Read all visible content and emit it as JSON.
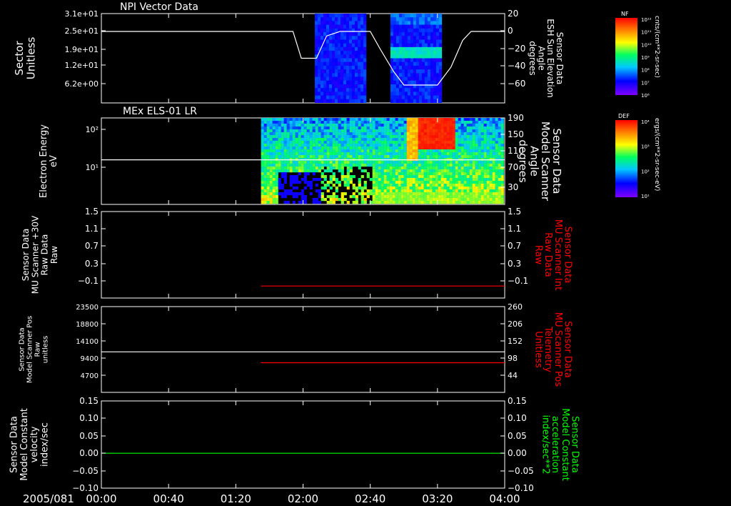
{
  "time_axis": {
    "date_label": "2005/081",
    "ticks": [
      "00:00",
      "00:40",
      "01:20",
      "02:00",
      "02:40",
      "03:20",
      "04:00"
    ],
    "start_min": 0,
    "end_min": 240
  },
  "chart_data": [
    {
      "type": "heatmap",
      "title": "NPI Vector Data",
      "ylabel": "Sector\nUnitless",
      "y_ticks": [
        "3.1e+01",
        "2.5e+01",
        "1.9e+01",
        "1.2e+01",
        "6.2e+00"
      ],
      "y2label": "Sensor Data\nESH Sun Elevation\nAngle\ndegrees",
      "y2_ticks": [
        "20",
        "0",
        "−20",
        "−40",
        "−60"
      ],
      "y2lim": [
        -80,
        20
      ],
      "colorbar": {
        "label": "NF",
        "unit": "cnts/(cm**2-sr-sec)",
        "ticks": [
          "10¹²",
          "10¹¹",
          "10¹⁰",
          "10⁹",
          "10⁸",
          "10⁷",
          "10⁶"
        ]
      },
      "data_intervals": [
        {
          "start_min": 127,
          "end_min": 158
        },
        {
          "start_min": 172,
          "end_min": 203
        }
      ],
      "line_series": {
        "name": "ESH Sun Elevation Angle",
        "color": "#ffffff",
        "points": [
          [
            0,
            0
          ],
          [
            114,
            0
          ],
          [
            119,
            -30
          ],
          [
            128,
            -30
          ],
          [
            134,
            -5
          ],
          [
            142,
            0
          ],
          [
            160,
            0
          ],
          [
            166,
            -20
          ],
          [
            174,
            -45
          ],
          [
            180,
            -60
          ],
          [
            200,
            -60
          ],
          [
            208,
            -40
          ],
          [
            215,
            -10
          ],
          [
            220,
            0
          ],
          [
            240,
            0
          ]
        ]
      }
    },
    {
      "type": "heatmap",
      "title": "MEx ELS-01 LR",
      "ylabel": "Electron Energy\neV",
      "y_ticks": [
        "10²",
        "10¹"
      ],
      "yscale": "log",
      "y2label": "Sensor Data\nModel Scanner\nAngle\ndegrees",
      "y2_ticks": [
        "190",
        "150",
        "110",
        "70",
        "30"
      ],
      "y2lim": [
        0,
        190
      ],
      "colorbar": {
        "label": "DEF",
        "unit": "ergs/(cm**2-sr-sec-eV)",
        "ticks": [
          "10⁴",
          "10³",
          "10²",
          "10¹"
        ]
      },
      "data_interval": {
        "start_min": 95,
        "end_min": 240
      },
      "line_series": {
        "name": "Model Scanner Angle",
        "color": "#ffffff",
        "constant": 98
      }
    },
    {
      "type": "line",
      "ylabel": "Sensor Data\nMU Scanner +30V\nRaw Data\nRaw",
      "y_ticks": [
        "1.5",
        "1.1",
        "0.7",
        "0.3",
        "−0.1"
      ],
      "ylim": [
        -0.3,
        1.5
      ],
      "y2label": "Sensor Data\nMU Scanner Int\nRaw Data\nRaw",
      "y2_ticks": [
        "1.5",
        "1.1",
        "0.7",
        "0.3",
        "−0.1"
      ],
      "y2lim": [
        -0.3,
        1.5
      ],
      "y2_color": "#ff0000",
      "series": [
        {
          "name": "MU Scanner Int",
          "color": "#ff0000",
          "axis": "right",
          "x": [
            95,
            240
          ],
          "values": [
            -0.05,
            -0.05
          ]
        }
      ]
    },
    {
      "type": "line",
      "ylabel": "Sensor Data\nModel Scanner Pos\nRaw\nunitless",
      "y_ticks": [
        "23500",
        "18800",
        "14100",
        "9400",
        "4700"
      ],
      "ylim": [
        0,
        23500
      ],
      "y2label": "Sensor Data\nMU Scanner Pos\nTelemetry\nUnitless",
      "y2_ticks": [
        "260",
        "206",
        "152",
        "98",
        "44"
      ],
      "y2lim": [
        0,
        260
      ],
      "y2_color": "#ff0000",
      "series": [
        {
          "name": "Model Scanner Pos",
          "color": "#ffffff",
          "axis": "left",
          "x": [
            0,
            240
          ],
          "values": [
            11100,
            11100
          ]
        },
        {
          "name": "MU Scanner Pos",
          "color": "#ff0000",
          "axis": "right",
          "x": [
            95,
            240
          ],
          "values": [
            90,
            90
          ]
        }
      ]
    },
    {
      "type": "line",
      "ylabel": "Sensor Data\nModel Constant\nvelocity\nindex/sec",
      "y_ticks": [
        "0.15",
        "0.10",
        "0.05",
        "0.00",
        "−0.05",
        "−0.10"
      ],
      "ylim": [
        -0.1,
        0.15
      ],
      "y2label": "Sensor Data\nModel Constant\nacceleration\nindex/sec**2",
      "y2_ticks": [
        "0.15",
        "0.10",
        "0.05",
        "0.00",
        "−0.05",
        "−0.10"
      ],
      "y2lim": [
        -0.1,
        0.15
      ],
      "y2_color": "#00ff00",
      "series": [
        {
          "name": "Model Constant acceleration",
          "color": "#00ff00",
          "axis": "right",
          "x": [
            0,
            240
          ],
          "values": [
            0,
            0
          ]
        }
      ]
    }
  ]
}
